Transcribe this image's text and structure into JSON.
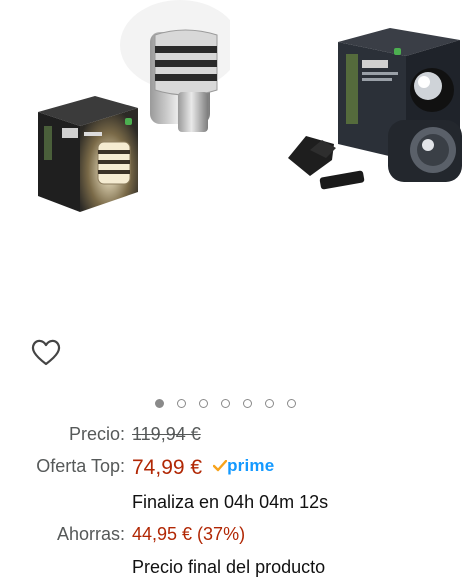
{
  "gallery": {
    "image_count": 7,
    "active_index": 0,
    "product_left_name": "Philips Hue Tuar outdoor wall lantern",
    "product_right_name": "Philips Hue outdoor motion sensor"
  },
  "wishlist": {
    "icon": "heart-outline-icon"
  },
  "pricing": {
    "list_price_label": "Precio:",
    "list_price": "119,94 €",
    "deal_label": "Oferta Top:",
    "deal_price": "74,99 €",
    "prime_label": "prime",
    "countdown": "Finaliza en 04h 04m 12s",
    "savings_label": "Ahorras:",
    "savings_value": "44,95 € (37%)",
    "final_price_note": "Precio final del producto"
  },
  "colors": {
    "deal_red": "#b12704",
    "prime_blue": "#1399ff",
    "prime_check_orange": "#f7a31c",
    "muted_text": "#565959"
  }
}
